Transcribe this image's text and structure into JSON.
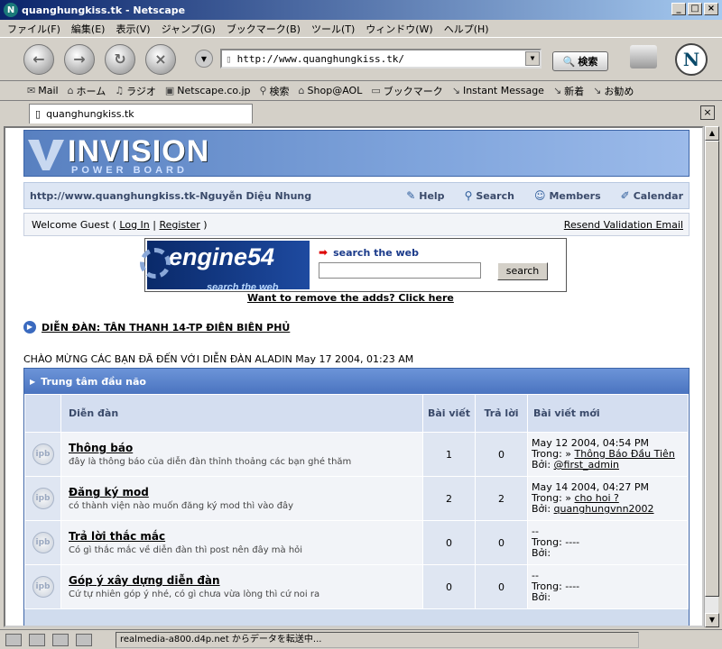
{
  "window": {
    "title": "quanghungkiss.tk - Netscape",
    "min": "_",
    "max": "□",
    "close": "×"
  },
  "menu": [
    "ファイル(F)",
    "編集(E)",
    "表示(V)",
    "ジャンプ(G)",
    "ブックマーク(B)",
    "ツール(T)",
    "ウィンドウ(W)",
    "ヘルプ(H)"
  ],
  "nav": {
    "url": "http://www.quanghungkiss.tk/",
    "search_label": "検索"
  },
  "bookmarks": [
    "Mail",
    "ホーム",
    "ラジオ",
    "Netscape.co.jp",
    "検索",
    "Shop@AOL",
    "ブックマーク",
    "Instant Message",
    "新着",
    "お勧め"
  ],
  "tab": {
    "title": "quanghungkiss.tk"
  },
  "status": {
    "text": "realmedia-a800.d4p.net からデータを転送中..."
  },
  "page": {
    "logo_title": "INVISION",
    "logo_sub": "POWER BOARD",
    "site_line": "http://www.quanghungkiss.tk-Nguyễn Diệu Nhung",
    "links": {
      "help": "Help",
      "search": "Search",
      "members": "Members",
      "calendar": "Calendar"
    },
    "welcome": {
      "prefix": "Welcome Guest ( ",
      "login": "Log In",
      "sep": " | ",
      "register": "Register",
      "suffix": " )",
      "resend": "Resend Validation Email"
    },
    "banner": {
      "logo": "engine54",
      "tagline": "search the web",
      "link": "search the web",
      "button": "search"
    },
    "remove_ads": "Want to remove the adds? Click here",
    "forum_title": "DIỄN ĐÀN: TÂN THANH 14-TP ĐIÊN BIÊN PHỦ",
    "greeting": "CHÀO MỪNG CÁC BẠN ĐÃ ĐẾN VỚI DIỄN ĐÀN ALADIN May 17 2004, 01:23 AM",
    "category": "Trung tâm đầu não",
    "columns": {
      "forum": "Diễn đàn",
      "posts": "Bài viết",
      "replies": "Trả lời",
      "last": "Bài viết mới"
    },
    "rows": [
      {
        "name": "Thông báo",
        "desc": "đây là thông báo của diễn đàn thỉnh thoảng các bạn ghé thăm",
        "posts": "1",
        "replies": "0",
        "date": "May 12 2004, 04:54 PM",
        "in": "Trong: »",
        "topic": "Thông Báo Đầu Tiên",
        "by": "Bởi:",
        "user": "@first_admin"
      },
      {
        "name": "Đăng ký mod",
        "desc": "có thành viện nào muốn đăng ký mod thì vào đây",
        "posts": "2",
        "replies": "2",
        "date": "May 14 2004, 04:27 PM",
        "in": "Trong: »",
        "topic": "cho hoi ?",
        "by": "Bởi:",
        "user": "quanghungvnn2002"
      },
      {
        "name": "Trả lời thắc mắc",
        "desc": "Có gì thắc mắc về diễn đàn thì post nên đây mà hỏi",
        "posts": "0",
        "replies": "0",
        "date": "--",
        "in": "Trong: ----",
        "topic": "",
        "by": "Bởi:",
        "user": ""
      },
      {
        "name": "Góp ý xây dựng diễn đàn",
        "desc": "Cứ tự nhiên góp ý nhé, có gì chưa vừa lòng thì cứ noi ra",
        "posts": "0",
        "replies": "0",
        "date": "--",
        "in": "Trong: ----",
        "topic": "",
        "by": "Bởi:",
        "user": ""
      }
    ]
  }
}
